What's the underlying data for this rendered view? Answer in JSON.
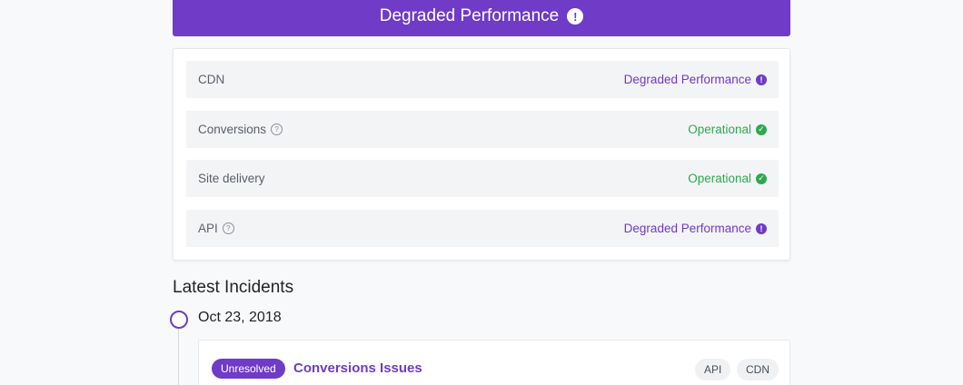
{
  "banner": {
    "text": "Degraded Performance",
    "icon": "exclamation-circle-icon",
    "color": "#6f3bc7"
  },
  "components": [
    {
      "name": "CDN",
      "help": false,
      "status": "Degraded Performance",
      "status_type": "degraded"
    },
    {
      "name": "Conversions",
      "help": true,
      "status": "Operational",
      "status_type": "operational"
    },
    {
      "name": "Site delivery",
      "help": false,
      "status": "Operational",
      "status_type": "operational"
    },
    {
      "name": "API",
      "help": true,
      "status": "Degraded Performance",
      "status_type": "degraded"
    }
  ],
  "icons": {
    "help": "?",
    "degraded": "!",
    "operational": "✓"
  },
  "colors": {
    "degraded": "#6f3bc7",
    "operational": "#2fa84f"
  },
  "incidents": {
    "title": "Latest Incidents",
    "date": "Oct 23, 2018",
    "items": [
      {
        "badge": "Unresolved",
        "title": "Conversions Issues",
        "tags": [
          "API",
          "CDN"
        ]
      }
    ]
  }
}
